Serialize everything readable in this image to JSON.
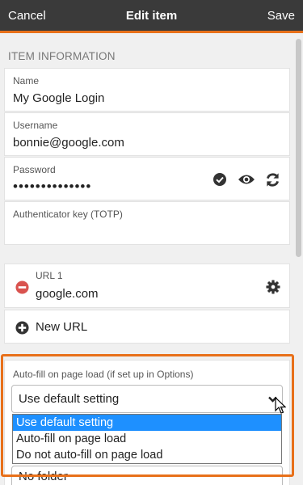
{
  "header": {
    "cancel_label": "Cancel",
    "title": "Edit item",
    "save_label": "Save"
  },
  "item_info": {
    "section_title": "ITEM INFORMATION",
    "name": {
      "label": "Name",
      "value": "My Google Login"
    },
    "username": {
      "label": "Username",
      "value": "bonnie@google.com"
    },
    "password": {
      "label": "Password",
      "value": "••••••••••••••"
    },
    "totp": {
      "label": "Authenticator key (TOTP)",
      "value": ""
    }
  },
  "urls": {
    "url1": {
      "label": "URL 1",
      "value": "google.com"
    },
    "new_url_label": "New URL"
  },
  "autofill": {
    "label": "Auto-fill on page load (if set up in Options)",
    "selected": "Use default setting",
    "options": [
      "Use default setting",
      "Auto-fill on page load",
      "Do not auto-fill on page load"
    ]
  },
  "folder": {
    "value": "No folder"
  },
  "colors": {
    "accent": "#e8701a",
    "header_bg": "#3a3a3a",
    "remove_red": "#d9534f",
    "selected_blue": "#1e90ff"
  },
  "icons": [
    "check-circle-icon",
    "eye-icon",
    "refresh-icon",
    "minus-circle-icon",
    "gear-icon",
    "plus-circle-icon",
    "chevron-down-icon",
    "cursor-icon"
  ]
}
